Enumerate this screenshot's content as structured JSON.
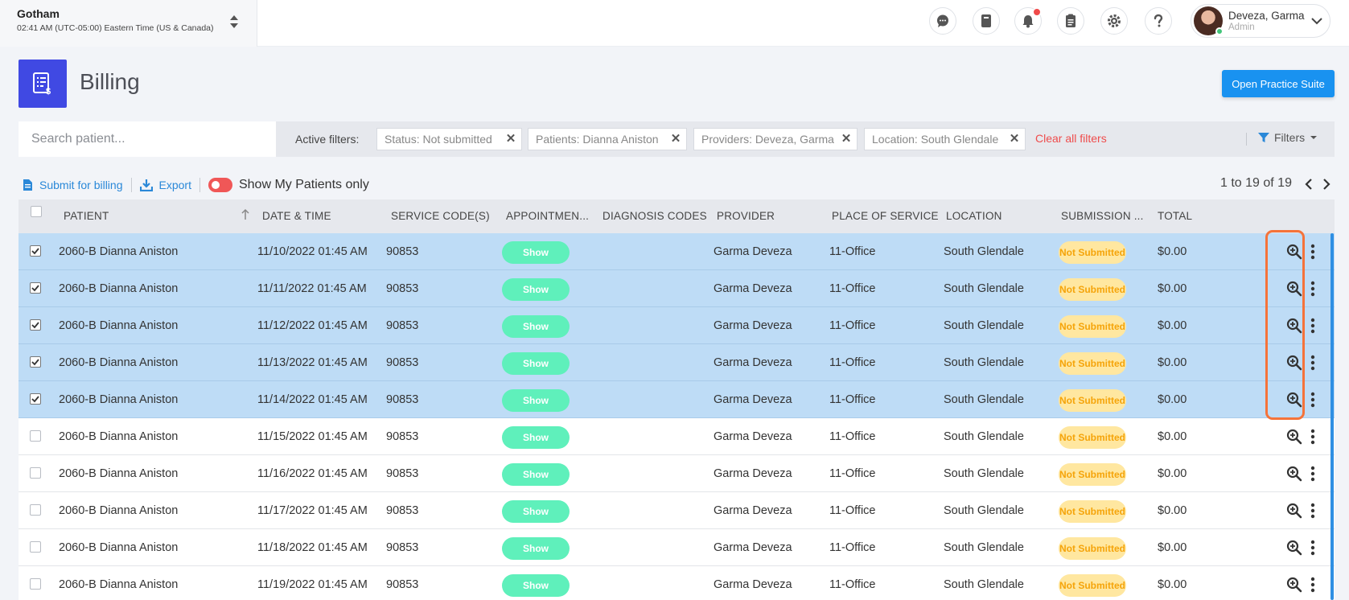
{
  "org": {
    "name": "Gotham",
    "time": "02:41 AM (UTC-05:00) Eastern Time (US & Canada)"
  },
  "user": {
    "name": "Deveza, Garma",
    "role": "Admin"
  },
  "topbar_icons": [
    "chat-icon",
    "book-icon",
    "bell-icon",
    "clipboard-icon",
    "gear-icon",
    "help-icon"
  ],
  "page": {
    "title": "Billing",
    "open_suite_label": "Open Practice Suite"
  },
  "filters": {
    "search_placeholder": "Search patient...",
    "active_label": "Active filters:",
    "chips": [
      "Status: Not submitted",
      "Patients: Dianna Aniston",
      "Providers: Deveza, Garma",
      "Location: South Glendale"
    ],
    "clear_all": "Clear all filters",
    "filters_label": "Filters"
  },
  "actions": {
    "submit": "Submit for billing",
    "export": "Export",
    "my_patients": "Show My Patients only"
  },
  "pager": {
    "text": "1 to 19 of 19"
  },
  "columns": [
    "PATIENT",
    "DATE & TIME",
    "SERVICE CODE(S)",
    "APPOINTMEN...",
    "DIAGNOSIS CODES",
    "PROVIDER",
    "PLACE OF SERVICE",
    "LOCATION",
    "SUBMISSION ...",
    "TOTAL"
  ],
  "rows": [
    {
      "patient": "2060-B Dianna Aniston",
      "datetime": "11/10/2022 01:45 AM",
      "code": "90853",
      "appt": "Show",
      "diag": "",
      "provider": "Garma Deveza",
      "place": "11-Office",
      "location": "South Glendale",
      "submission": "Not Submitted",
      "total": "$0.00",
      "selected": true
    },
    {
      "patient": "2060-B Dianna Aniston",
      "datetime": "11/11/2022 01:45 AM",
      "code": "90853",
      "appt": "Show",
      "diag": "",
      "provider": "Garma Deveza",
      "place": "11-Office",
      "location": "South Glendale",
      "submission": "Not Submitted",
      "total": "$0.00",
      "selected": true
    },
    {
      "patient": "2060-B Dianna Aniston",
      "datetime": "11/12/2022 01:45 AM",
      "code": "90853",
      "appt": "Show",
      "diag": "",
      "provider": "Garma Deveza",
      "place": "11-Office",
      "location": "South Glendale",
      "submission": "Not Submitted",
      "total": "$0.00",
      "selected": true
    },
    {
      "patient": "2060-B Dianna Aniston",
      "datetime": "11/13/2022 01:45 AM",
      "code": "90853",
      "appt": "Show",
      "diag": "",
      "provider": "Garma Deveza",
      "place": "11-Office",
      "location": "South Glendale",
      "submission": "Not Submitted",
      "total": "$0.00",
      "selected": true
    },
    {
      "patient": "2060-B Dianna Aniston",
      "datetime": "11/14/2022 01:45 AM",
      "code": "90853",
      "appt": "Show",
      "diag": "",
      "provider": "Garma Deveza",
      "place": "11-Office",
      "location": "South Glendale",
      "submission": "Not Submitted",
      "total": "$0.00",
      "selected": true
    },
    {
      "patient": "2060-B Dianna Aniston",
      "datetime": "11/15/2022 01:45 AM",
      "code": "90853",
      "appt": "Show",
      "diag": "",
      "provider": "Garma Deveza",
      "place": "11-Office",
      "location": "South Glendale",
      "submission": "Not Submitted",
      "total": "$0.00",
      "selected": false
    },
    {
      "patient": "2060-B Dianna Aniston",
      "datetime": "11/16/2022 01:45 AM",
      "code": "90853",
      "appt": "Show",
      "diag": "",
      "provider": "Garma Deveza",
      "place": "11-Office",
      "location": "South Glendale",
      "submission": "Not Submitted",
      "total": "$0.00",
      "selected": false
    },
    {
      "patient": "2060-B Dianna Aniston",
      "datetime": "11/17/2022 01:45 AM",
      "code": "90853",
      "appt": "Show",
      "diag": "",
      "provider": "Garma Deveza",
      "place": "11-Office",
      "location": "South Glendale",
      "submission": "Not Submitted",
      "total": "$0.00",
      "selected": false
    },
    {
      "patient": "2060-B Dianna Aniston",
      "datetime": "11/18/2022 01:45 AM",
      "code": "90853",
      "appt": "Show",
      "diag": "",
      "provider": "Garma Deveza",
      "place": "11-Office",
      "location": "South Glendale",
      "submission": "Not Submitted",
      "total": "$0.00",
      "selected": false
    },
    {
      "patient": "2060-B Dianna Aniston",
      "datetime": "11/19/2022 01:45 AM",
      "code": "90853",
      "appt": "Show",
      "diag": "",
      "provider": "Garma Deveza",
      "place": "11-Office",
      "location": "South Glendale",
      "submission": "Not Submitted",
      "total": "$0.00",
      "selected": false
    }
  ],
  "colors": {
    "brand": "#4049e3",
    "primary_button": "#1992f0",
    "link": "#2a88d8",
    "selected_row": "#bedcf6",
    "show_pill": "#5ff0bb",
    "not_submitted_pill": "#ffe7a0",
    "highlight": "#f5733a"
  }
}
